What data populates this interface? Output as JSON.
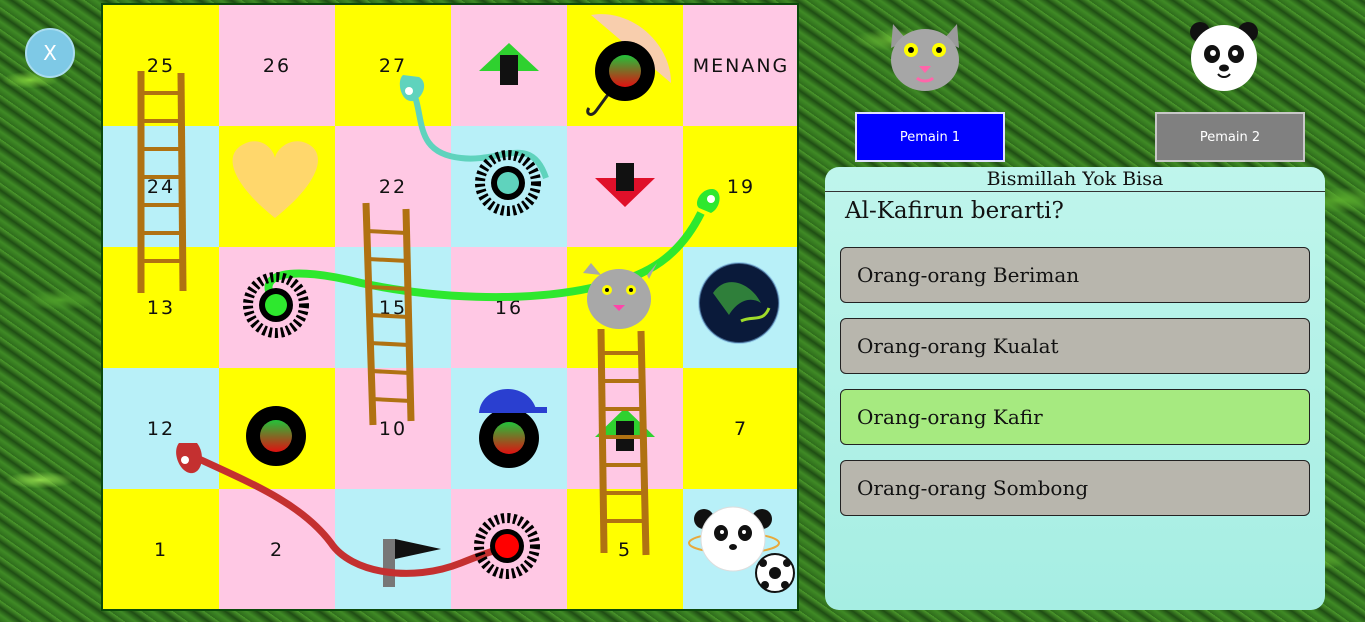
{
  "close_button": {
    "label": "X"
  },
  "board": {
    "cells": [
      {
        "label": "25",
        "color": "yellow"
      },
      {
        "label": "26",
        "color": "pink"
      },
      {
        "label": "27",
        "color": "yellow"
      },
      {
        "label": "",
        "color": "pink"
      },
      {
        "label": "",
        "color": "yellow"
      },
      {
        "label": "MENANG",
        "color": "pink"
      },
      {
        "label": "24",
        "color": "blue"
      },
      {
        "label": "",
        "color": "yellow"
      },
      {
        "label": "22",
        "color": "pink"
      },
      {
        "label": "",
        "color": "blue"
      },
      {
        "label": "",
        "color": "pink"
      },
      {
        "label": "19",
        "color": "yellow"
      },
      {
        "label": "13",
        "color": "yellow"
      },
      {
        "label": "",
        "color": "pink"
      },
      {
        "label": "15",
        "color": "blue"
      },
      {
        "label": "16",
        "color": "pink"
      },
      {
        "label": "",
        "color": "yellow"
      },
      {
        "label": "",
        "color": "blue"
      },
      {
        "label": "12",
        "color": "blue"
      },
      {
        "label": "",
        "color": "yellow"
      },
      {
        "label": "10",
        "color": "pink"
      },
      {
        "label": "",
        "color": "blue"
      },
      {
        "label": "",
        "color": "pink"
      },
      {
        "label": "7",
        "color": "yellow"
      },
      {
        "label": "1",
        "color": "yellow"
      },
      {
        "label": "2",
        "color": "pink"
      },
      {
        "label": "",
        "color": "blue"
      },
      {
        "label": "",
        "color": "pink"
      },
      {
        "label": "5",
        "color": "yellow"
      },
      {
        "label": "",
        "color": "blue"
      }
    ]
  },
  "players": {
    "player1": {
      "label": "Pemain 1",
      "avatar": "cat-icon",
      "color": "#0000ff"
    },
    "player2": {
      "label": "Pemain 2",
      "avatar": "panda-icon",
      "color": "#808080"
    }
  },
  "quiz": {
    "title": "Bismillah Yok Bisa",
    "question": "Al-Kafirun berarti?",
    "options": [
      {
        "label": "Orang-orang Beriman",
        "state": "default"
      },
      {
        "label": "Orang-orang Kualat",
        "state": "default"
      },
      {
        "label": "Orang-orang Kafir",
        "state": "correct"
      },
      {
        "label": "Orang-orang Sombong",
        "state": "default"
      }
    ]
  }
}
